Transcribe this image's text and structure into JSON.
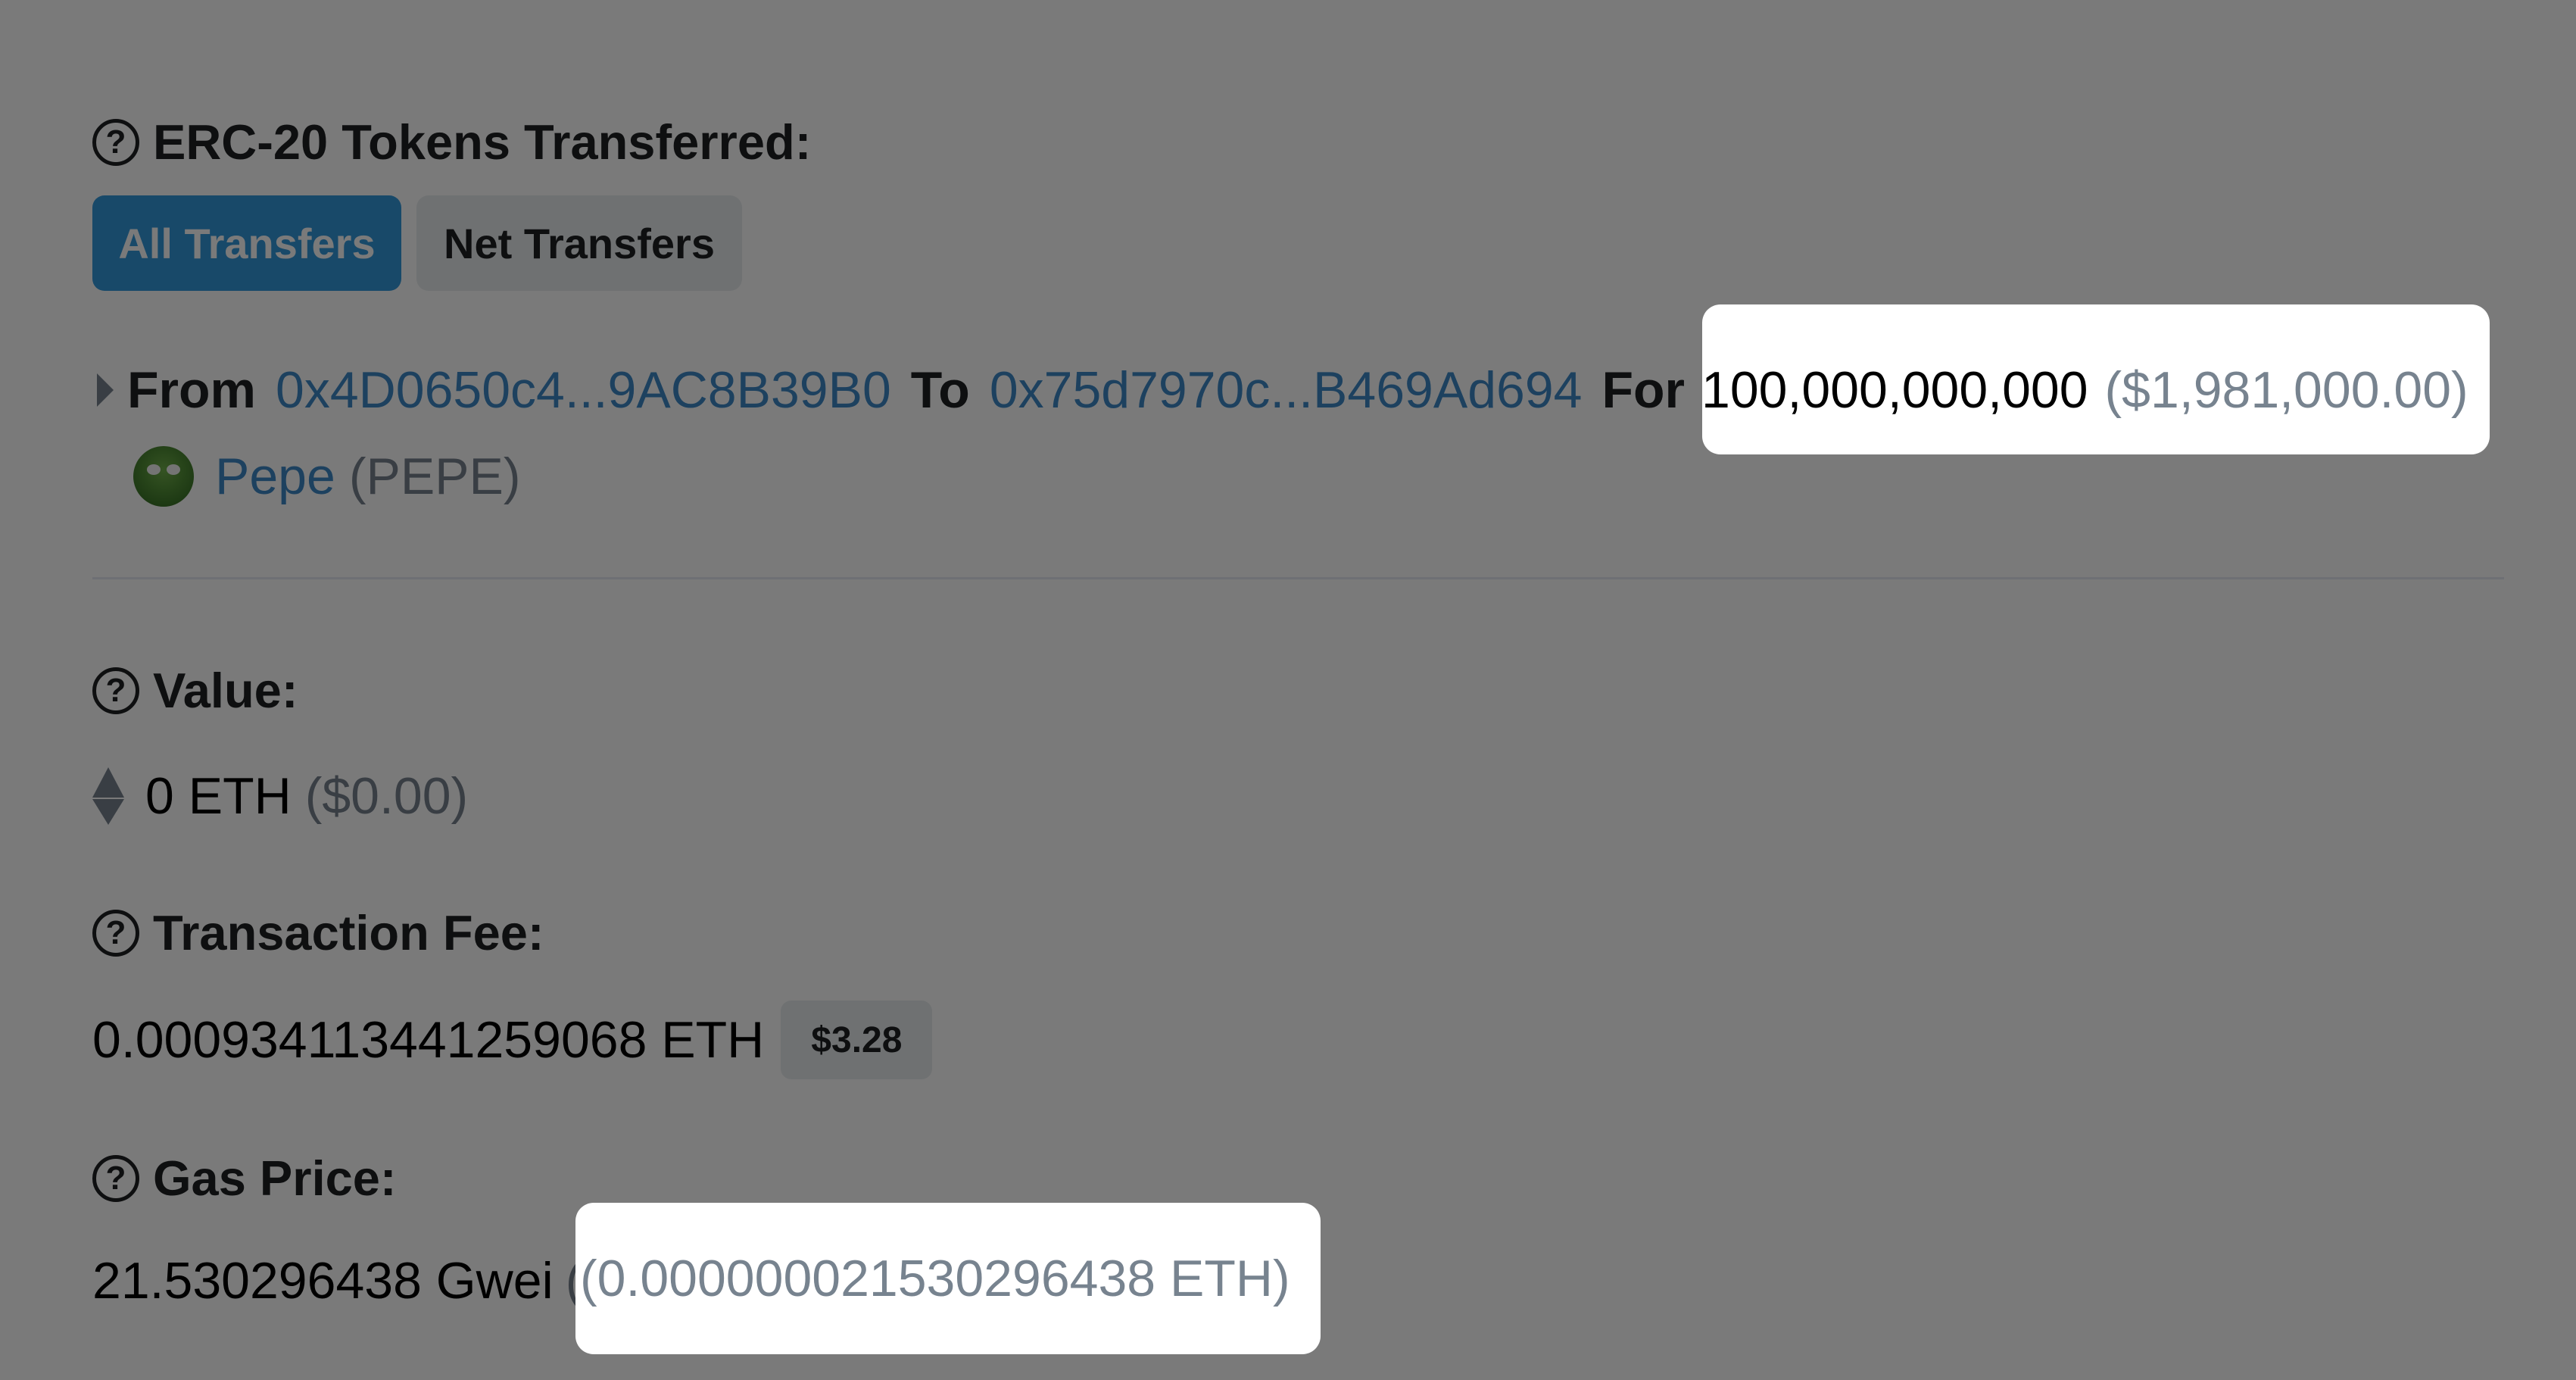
{
  "tokens_section": {
    "heading": "ERC-20 Tokens Transferred:",
    "tabs": [
      "All Transfers",
      "Net Transfers"
    ],
    "transfer": {
      "from_label": "From",
      "from_address": "0x4D0650c4...9AC8B39B0",
      "to_label": "To",
      "to_address": "0x75d7970c...B469Ad694",
      "for_label": "For",
      "amount": "100,000,000,000",
      "amount_usd": "($1,981,000.00)",
      "token_name": "Pepe",
      "token_symbol": "(PEPE)"
    }
  },
  "value_section": {
    "heading": "Value:",
    "amount": "0 ETH",
    "amount_usd": "($0.00)"
  },
  "fee_section": {
    "heading": "Transaction Fee:",
    "amount": "0.000934113441259068 ETH",
    "badge": "$3.28"
  },
  "gas_section": {
    "heading": "Gas Price:",
    "gwei": "21.530296438 Gwei",
    "eth": "(0.000000021530296438 ETH)"
  },
  "colors": {
    "primary_button": "#3498db",
    "link": "#3e89c7",
    "muted": "#77838f",
    "text": "#1e2022",
    "overlay": "rgba(0,0,0,0.52)"
  },
  "icons": [
    "question-circle-icon",
    "caret-right-icon",
    "pepe-token-icon",
    "ethereum-icon"
  ]
}
